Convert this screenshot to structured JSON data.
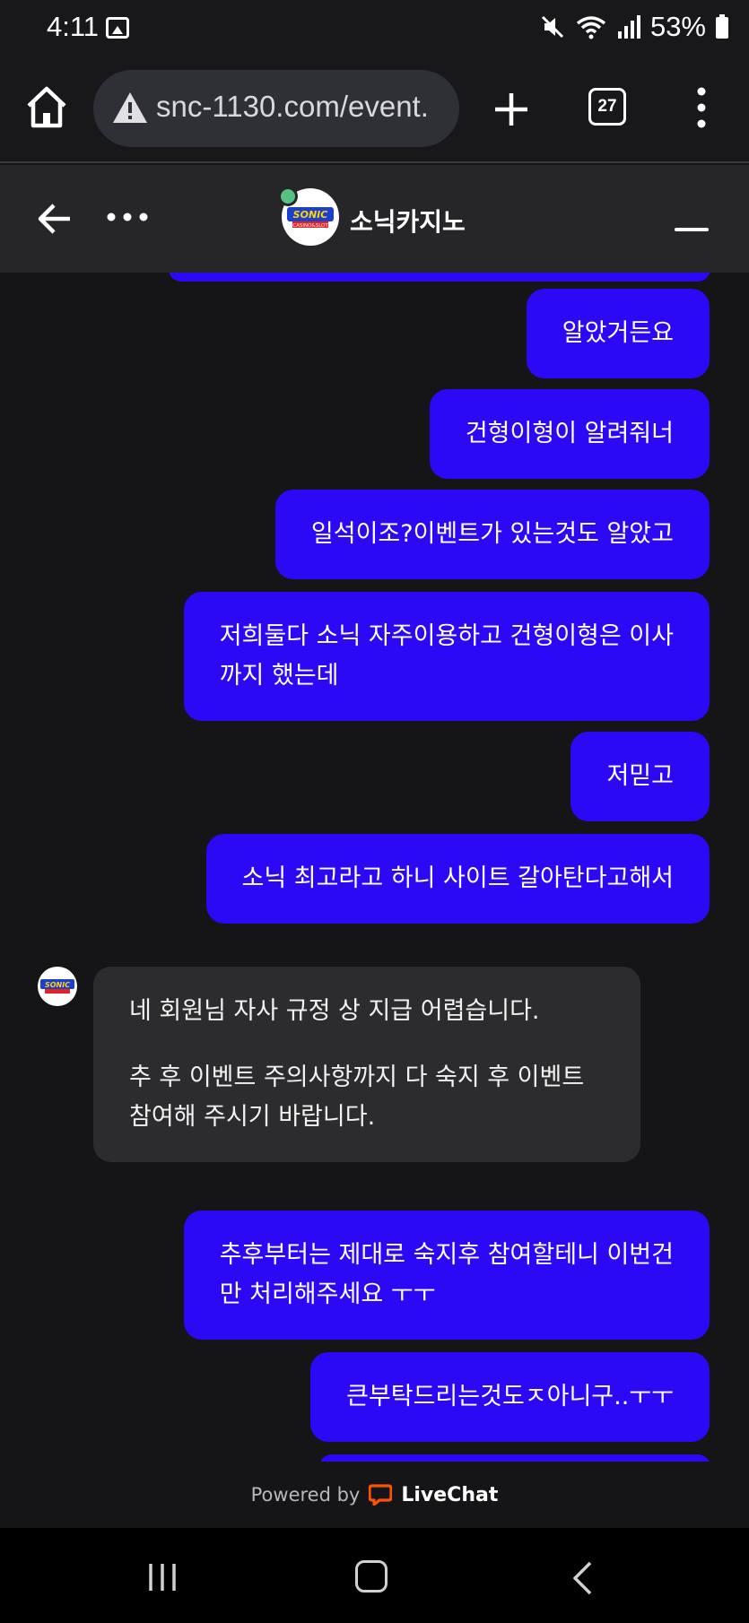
{
  "status_bar": {
    "time": "4:11",
    "battery": "53%",
    "icons": [
      "gallery-icon",
      "mute-icon",
      "wifi-icon",
      "signal-icon",
      "battery-icon"
    ]
  },
  "browser": {
    "url": "snc-1130.com/event.",
    "tab_count": "27",
    "icons": [
      "home-icon",
      "warning-icon",
      "plus-icon",
      "more-vertical-icon"
    ]
  },
  "chat_header": {
    "agent_name": "소닉카지노",
    "logo_text": "SONIC",
    "logo_subtext": "CASINO&SLOT",
    "status_color": "#55c27f"
  },
  "messages": [
    {
      "from": "user",
      "lines": [
        "알았거든요"
      ]
    },
    {
      "from": "user",
      "lines": [
        "건형이형이 알려줘너"
      ]
    },
    {
      "from": "user",
      "lines": [
        "일석이조?이벤트가 있는것도 알았고"
      ]
    },
    {
      "from": "user",
      "lines": [
        "저희둘다 소닉 자주이용하고 건형이형은 이사",
        "까지 했는데"
      ]
    },
    {
      "from": "user",
      "lines": [
        "저믿고"
      ]
    },
    {
      "from": "user",
      "lines": [
        "소닉 최고라고 하니 사이트 갈아탄다고해서"
      ]
    },
    {
      "from": "agent",
      "paragraphs": [
        "네 회원님 자사 규정 상 지급 어렵습니다.",
        "추 후 이벤트 주의사항까지 다 숙지 후 이벤트 참여해 주시기 바랍니다."
      ]
    },
    {
      "from": "user",
      "lines": [
        "추후부터는 제대로 숙지후 참여할테니 이번건",
        "만 처리해주세요 ㅜㅜ"
      ]
    },
    {
      "from": "user",
      "lines": [
        "큰부탁드리는것도ㅈ아니구..ㅜㅜ"
      ]
    }
  ],
  "footer": {
    "powered_by": "Powered by",
    "brand": "LiveChat",
    "brand_color": "#ff5100"
  },
  "colors": {
    "user_bubble": "#2b09f5",
    "agent_bubble": "#2c2c2e",
    "background": "#151517"
  }
}
